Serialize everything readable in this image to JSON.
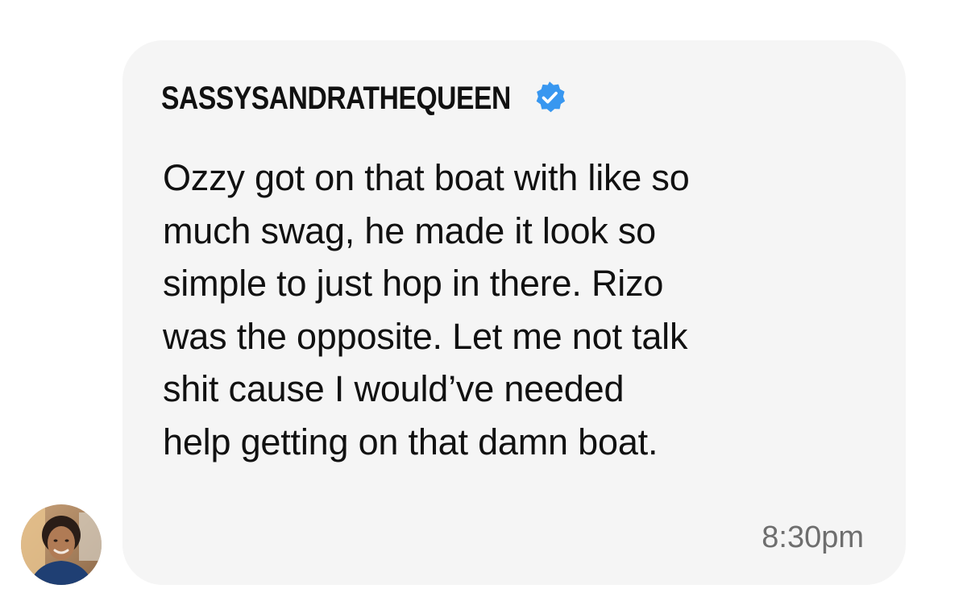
{
  "message": {
    "username": "SASSYSANDRATHEQUEEN",
    "verified": true,
    "body": "Ozzy got on that boat with like so\nmuch swag, he made it look so\nsimple to just hop in there. Rizo\nwas the opposite. Let me not talk\nshit cause I would’ve needed\nhelp getting on that damn boat.",
    "time": "8:30pm"
  },
  "icons": {
    "verified": "verified-badge-icon",
    "avatar": "user-avatar"
  },
  "colors": {
    "bubble_background": "#f5f5f5",
    "text": "#111111",
    "timestamp": "#6e6e6e",
    "verified_blue": "#3897f0"
  }
}
